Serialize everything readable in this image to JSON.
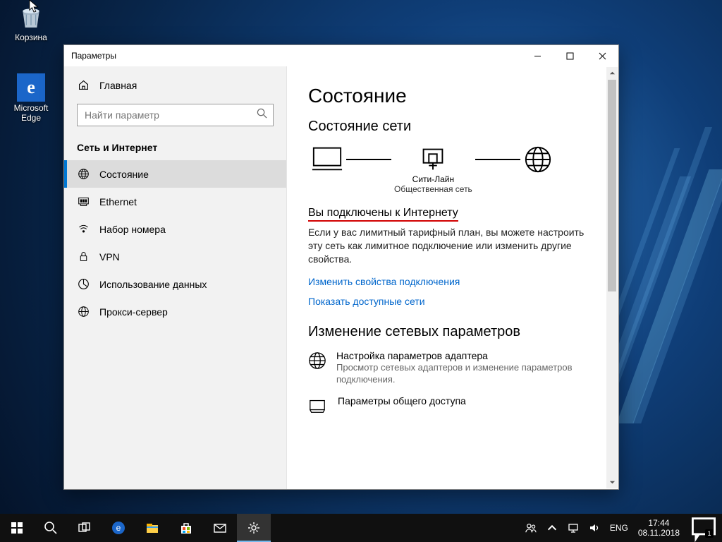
{
  "desktop": {
    "recycle_label": "Корзина",
    "edge_label": "Microsoft\nEdge"
  },
  "window": {
    "title": "Параметры",
    "home_label": "Главная",
    "search_placeholder": "Найти параметр",
    "section_label": "Сеть и Интернет",
    "nav": [
      {
        "label": "Состояние"
      },
      {
        "label": "Ethernet"
      },
      {
        "label": "Набор номера"
      },
      {
        "label": "VPN"
      },
      {
        "label": "Использование данных"
      },
      {
        "label": "Прокси-сервер"
      }
    ]
  },
  "main": {
    "h1": "Состояние",
    "h2": "Состояние сети",
    "net_name": "Сити-Лайн",
    "net_type": "Общественная сеть",
    "connected_heading": "Вы подключены к Интернету",
    "connected_desc": "Если у вас лимитный тарифный план, вы можете настроить эту сеть как лимитное подключение или изменить другие свойства.",
    "link_change": "Изменить свойства подключения",
    "link_show": "Показать доступные сети",
    "change_h2": "Изменение сетевых параметров",
    "opt1_title": "Настройка параметров адаптера",
    "opt1_desc": "Просмотр сетевых адаптеров и изменение параметров подключения.",
    "opt2_title": "Параметры общего доступа"
  },
  "taskbar": {
    "lang": "ENG",
    "time": "17:44",
    "date": "08.11.2018"
  }
}
